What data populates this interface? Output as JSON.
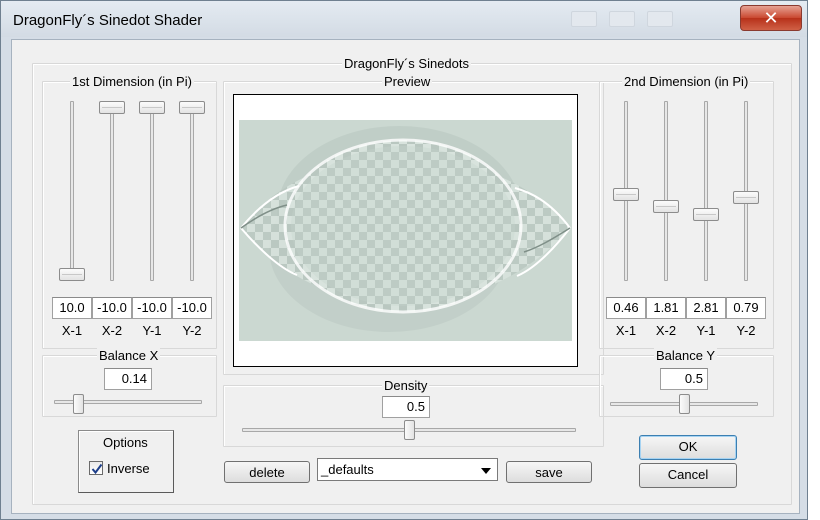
{
  "window": {
    "title": "DragonFly´s Sinedot Shader",
    "close_glyph": "✕",
    "left_edge_char": "3"
  },
  "main": {
    "group_title": "DragonFly´s Sinedots",
    "preview_label": "Preview"
  },
  "dim1": {
    "title": "1st Dimension (in Pi)",
    "range": [
      -10,
      10
    ],
    "sliders": [
      {
        "label": "X-1",
        "value": "10.0",
        "level": 10.0
      },
      {
        "label": "X-2",
        "value": "-10.0",
        "level": -10.0
      },
      {
        "label": "Y-1",
        "value": "-10.0",
        "level": -10.0
      },
      {
        "label": "Y-2",
        "value": "-10.0",
        "level": -10.0
      }
    ]
  },
  "dim2": {
    "title": "2nd Dimension (in Pi)",
    "range": [
      -10,
      10
    ],
    "sliders": [
      {
        "label": "X-1",
        "value": "0.46",
        "level": 0.46
      },
      {
        "label": "X-2",
        "value": "1.81",
        "level": 1.81
      },
      {
        "label": "Y-1",
        "value": "2.81",
        "level": 2.81
      },
      {
        "label": "Y-2",
        "value": "0.79",
        "level": 0.79
      }
    ]
  },
  "balance_x": {
    "title": "Balance X",
    "value": "0.14",
    "level": 0.14,
    "range": [
      0,
      1
    ]
  },
  "balance_y": {
    "title": "Balance Y",
    "value": "0.5",
    "level": 0.5,
    "range": [
      0,
      1
    ]
  },
  "density": {
    "title": "Density",
    "value": "0.5",
    "level": 0.5,
    "range": [
      0,
      1
    ]
  },
  "options": {
    "title": "Options",
    "inverse_label": "Inverse",
    "inverse_checked": true
  },
  "presets": {
    "delete_label": "delete",
    "selected": "_defaults",
    "save_label": "save"
  },
  "buttons": {
    "ok_label": "OK",
    "cancel_label": "Cancel"
  },
  "colors": {
    "preview_bg": "#cbd8d1",
    "close_red": "#c9472f",
    "checkmark": "#1e3f8a"
  }
}
